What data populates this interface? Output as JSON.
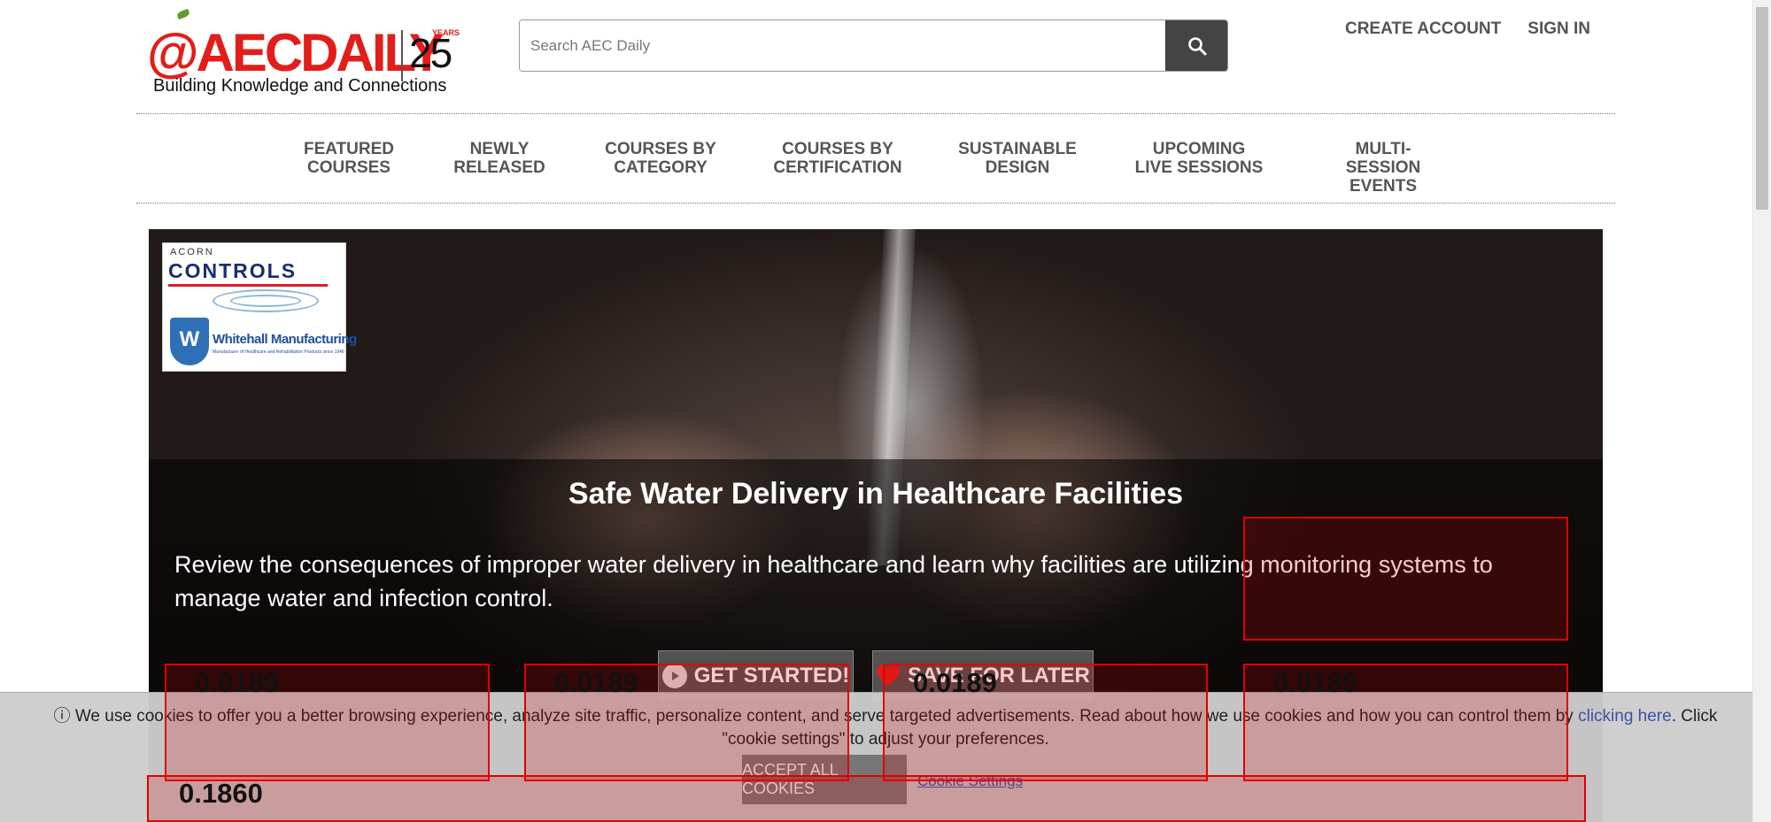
{
  "header": {
    "logo": {
      "brand": "@AECDAILY",
      "anniversary": "25",
      "years_label": "YEARS"
    },
    "tagline": "Building Knowledge and Connections",
    "search": {
      "placeholder": "Search AEC Daily"
    },
    "links": {
      "create_account": "CREATE ACCOUNT",
      "sign_in": "SIGN IN"
    }
  },
  "nav": {
    "items": [
      {
        "label": "FEATURED\nCOURSES"
      },
      {
        "label": "NEWLY\nRELEASED"
      },
      {
        "label": "COURSES BY\nCATEGORY"
      },
      {
        "label": "COURSES BY\nCERTIFICATION"
      },
      {
        "label": "SUSTAINABLE\nDESIGN"
      },
      {
        "label": "UPCOMING\nLIVE SESSIONS"
      },
      {
        "label": "MULTI-SESSION\nEVENTS"
      }
    ]
  },
  "hero": {
    "sponsor": {
      "line1": "ACORN",
      "line2": "CONTROLS",
      "registered": "®",
      "line3": "Whitehall Manufacturing",
      "shield_letter": "W",
      "tagline": "Manufacturer of Healthcare and Rehabilitation Products since 1946"
    },
    "title": "Safe Water Delivery in Healthcare Facilities",
    "description": "Review the consequences of improper water delivery in healthcare and learn why facilities are utilizing monitoring systems to manage water and infection control.",
    "buttons": {
      "start": "GET STARTED!",
      "save": "SAVE FOR LATER"
    }
  },
  "cookie_banner": {
    "icon": "info-icon",
    "text_before": "We use cookies to offer you a better browsing experience, analyze site traffic, personalize content, and serve targeted advertisements. Read about how we use cookies and how you can control them by ",
    "link": "clicking here",
    "text_after": ". Click \"cookie settings\" to adjust your preferences.",
    "accept": "ACCEPT ALL COOKIES",
    "settings": "Cookie Settings"
  },
  "overlays": {
    "labels": [
      "0.0189",
      "0.0189",
      "0.0189",
      "0.0189",
      "0.1860"
    ]
  },
  "colors": {
    "brand_red": "#e31d1a",
    "nav_text": "#555555",
    "overlay_red": "#e00000",
    "link_blue": "#3a53a4"
  }
}
